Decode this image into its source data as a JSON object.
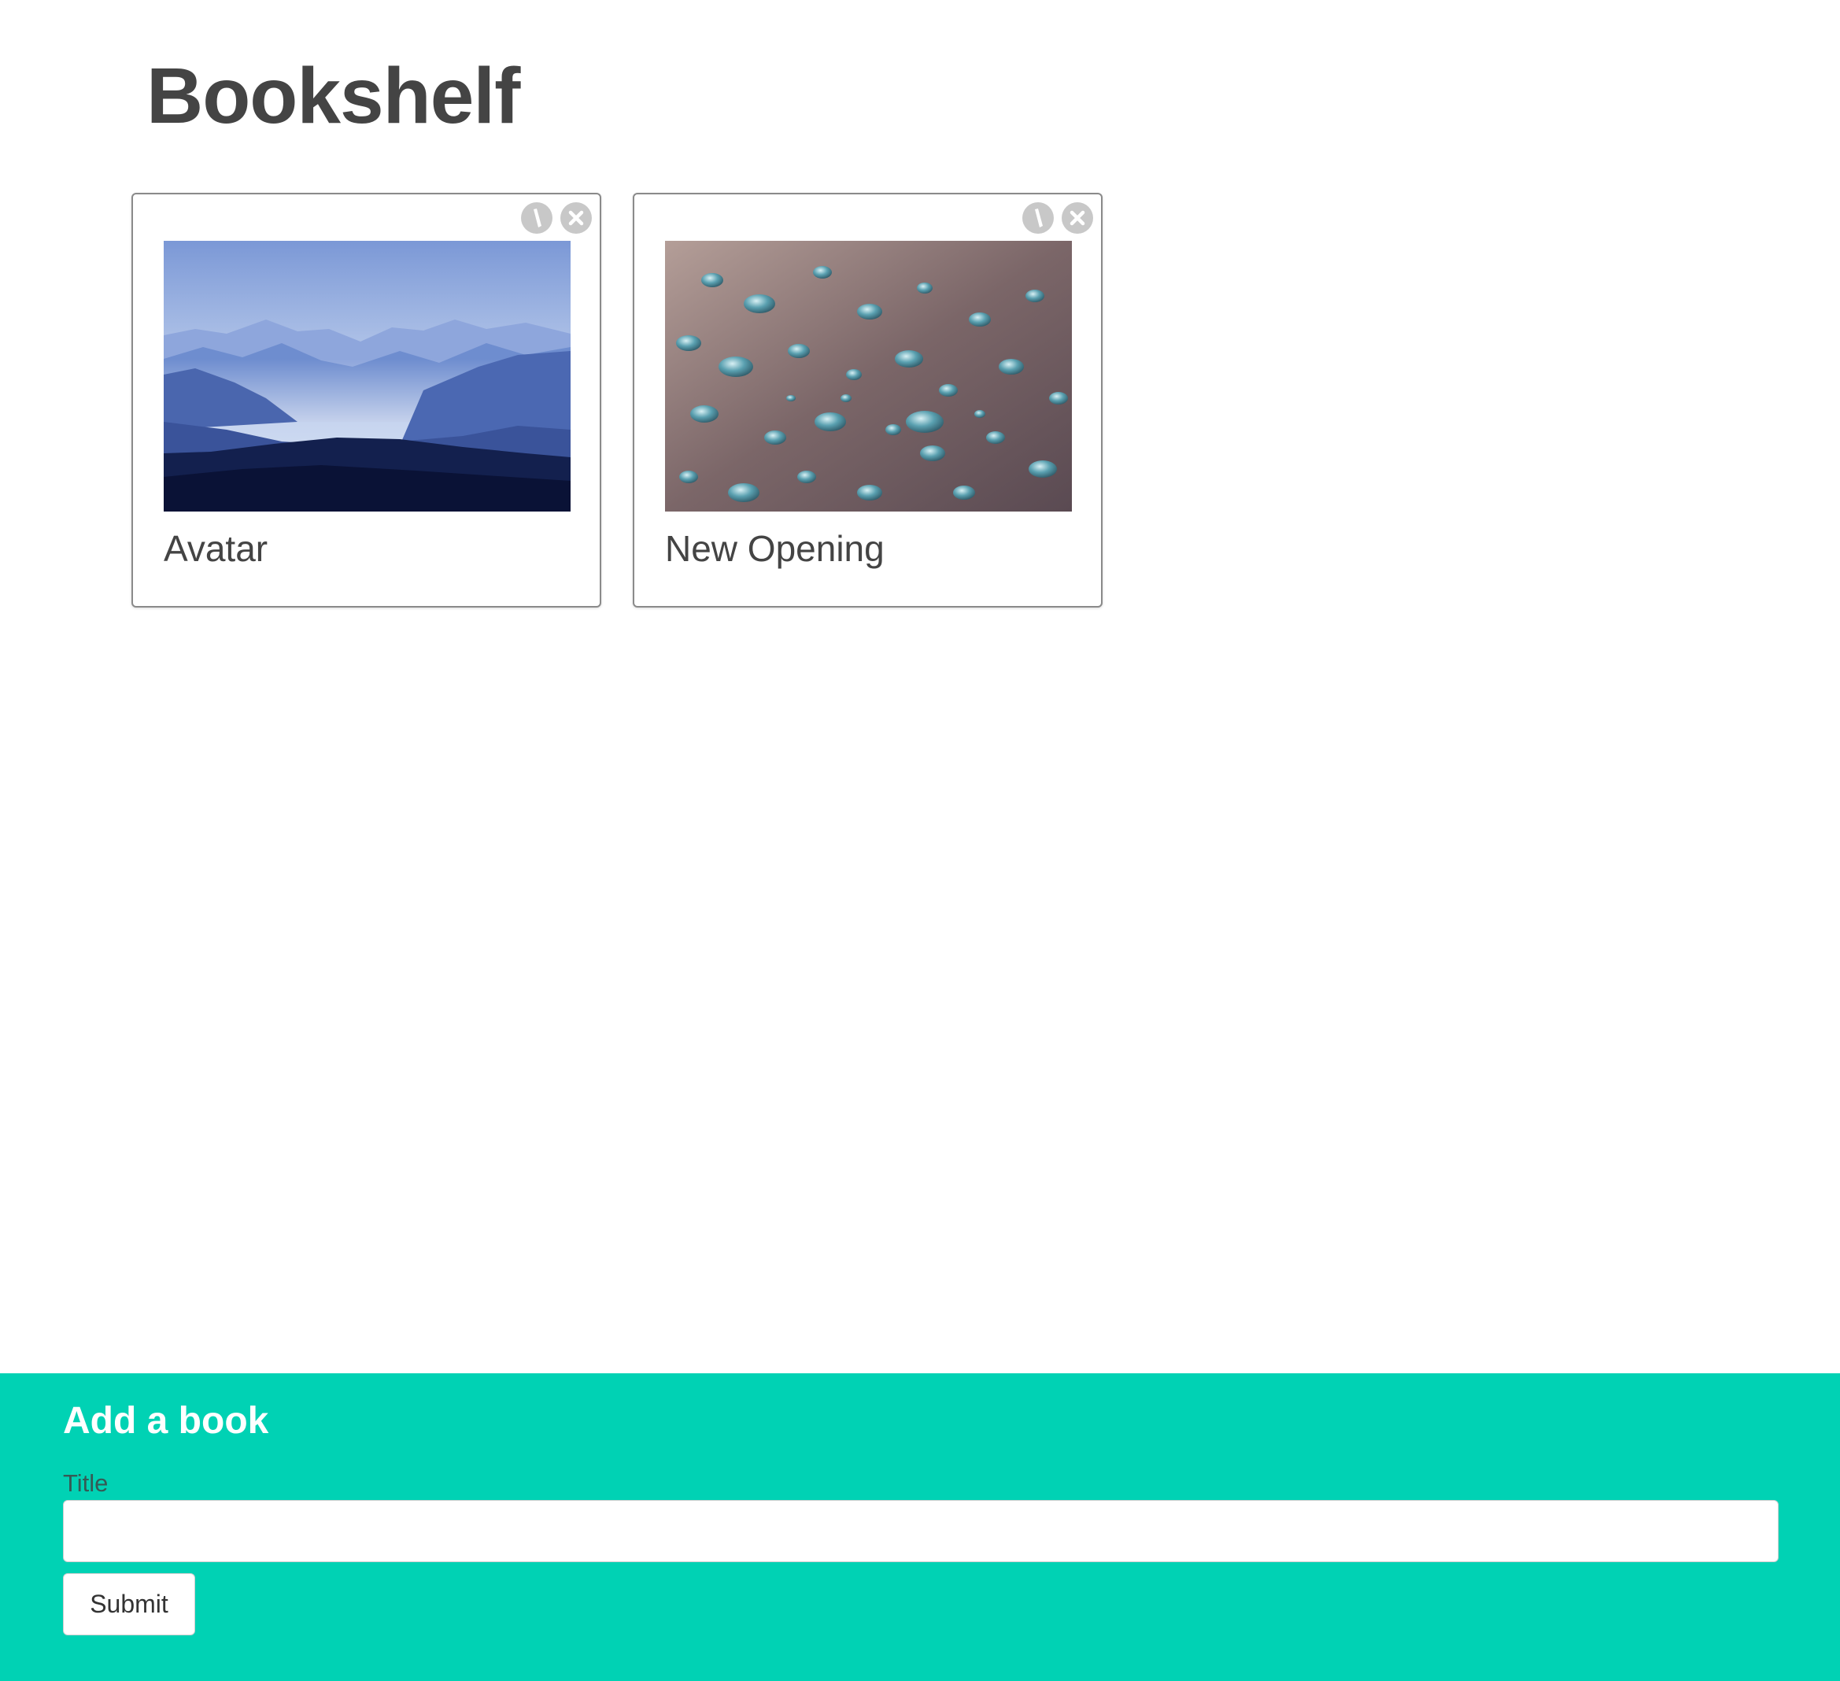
{
  "header": {
    "title": "Bookshelf"
  },
  "books": [
    {
      "title": "Avatar",
      "cover": "misty-blue-mountains-image",
      "actions": [
        "edit-icon",
        "close-icon"
      ]
    },
    {
      "title": "New Opening",
      "cover": "water-droplets-image",
      "actions": [
        "edit-icon",
        "close-icon"
      ]
    }
  ],
  "add_form": {
    "heading": "Add a book",
    "title_label": "Title",
    "title_value": "",
    "title_placeholder": "",
    "submit_label": "Submit"
  },
  "colors": {
    "panel_background": "#00d2b4",
    "icon_button": "#c8c8c8",
    "text": "#444444"
  }
}
